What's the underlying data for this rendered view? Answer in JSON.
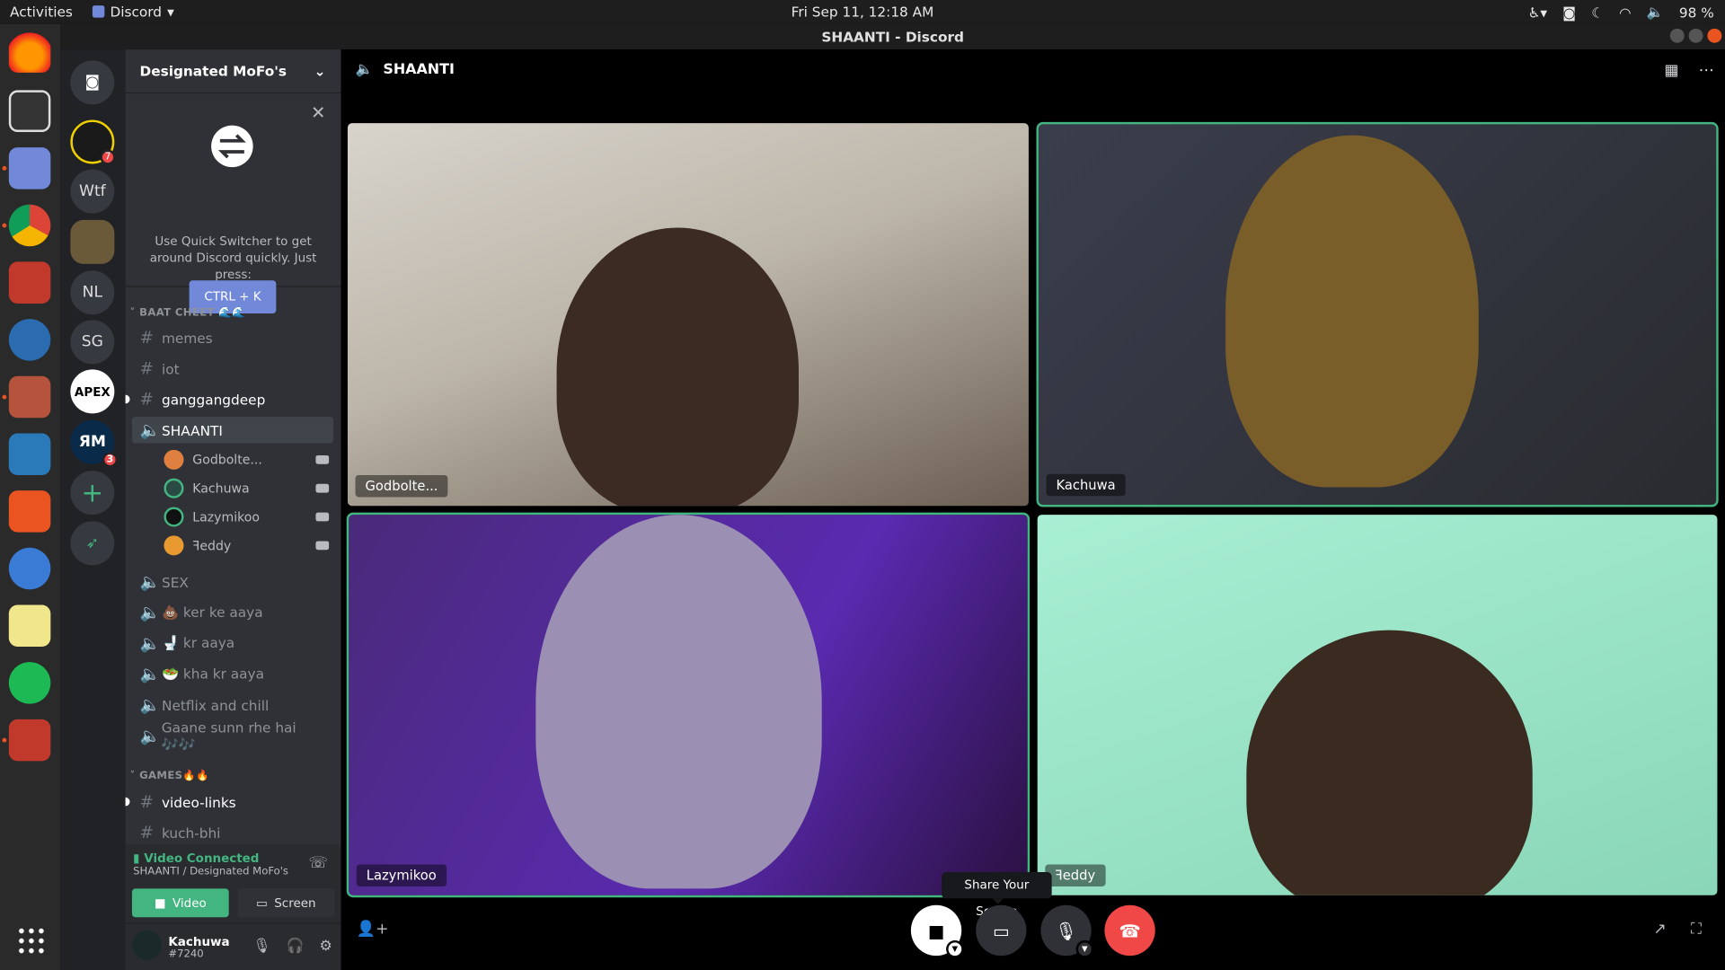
{
  "topbar": {
    "activities": "Activities",
    "app_name": "Discord",
    "clock": "Fri Sep 11, 12:18 AM",
    "battery": "98 %"
  },
  "window": {
    "title": "SHAANTI - Discord"
  },
  "guilds": [
    {
      "label": "",
      "badge": "7"
    },
    {
      "label": "Wtf",
      "badge": ""
    },
    {
      "label": "",
      "badge": ""
    },
    {
      "label": "NL",
      "badge": ""
    },
    {
      "label": "SG",
      "badge": ""
    },
    {
      "label": "APEX",
      "badge": ""
    },
    {
      "label": "ЯM",
      "badge": "3"
    }
  ],
  "server": {
    "name": "Designated MoFo's"
  },
  "quick_switcher": {
    "text": "Use Quick Switcher to get around Discord quickly. Just press:",
    "button": "CTRL + K"
  },
  "categories": {
    "baat_cheet": "BAAT CHEET 🌊🌊",
    "games": "GAMES🔥🔥"
  },
  "channels": {
    "memes": "memes",
    "iot": "iot",
    "ganggangdeep": "ganggangdeep",
    "shaanti": "SHAANTI",
    "sex": "SEX",
    "ker_ke_aaya": "💩 ker ke aaya",
    "kr_aaya": "🚽 kr aaya",
    "kha_kr_aaya": "🥗 kha kr aaya",
    "netflix": "Netflix and chill",
    "gaane": "Gaane sunn rhe hai 🎶🎶",
    "video_links": "video-links",
    "kuch_bhi": "kuch-bhi"
  },
  "voice_members": [
    "Godbolte...",
    "Kachuwa",
    "Lazymikoo",
    "ꟻeddy"
  ],
  "voice_panel": {
    "status": "Video Connected",
    "location": "SHAANTI / Designated MoFo's",
    "video_btn": "Video",
    "screen_btn": "Screen"
  },
  "user": {
    "name": "Kachuwa",
    "tag": "#7240"
  },
  "main": {
    "channel": "SHAANTI"
  },
  "tiles": [
    "Godbolte...",
    "Kachuwa",
    "Lazymikoo",
    "ꟻeddy"
  ],
  "tooltip": "Share Your Screen",
  "colors": {
    "accent": "#7289da",
    "green": "#43b581",
    "red": "#f04747"
  }
}
